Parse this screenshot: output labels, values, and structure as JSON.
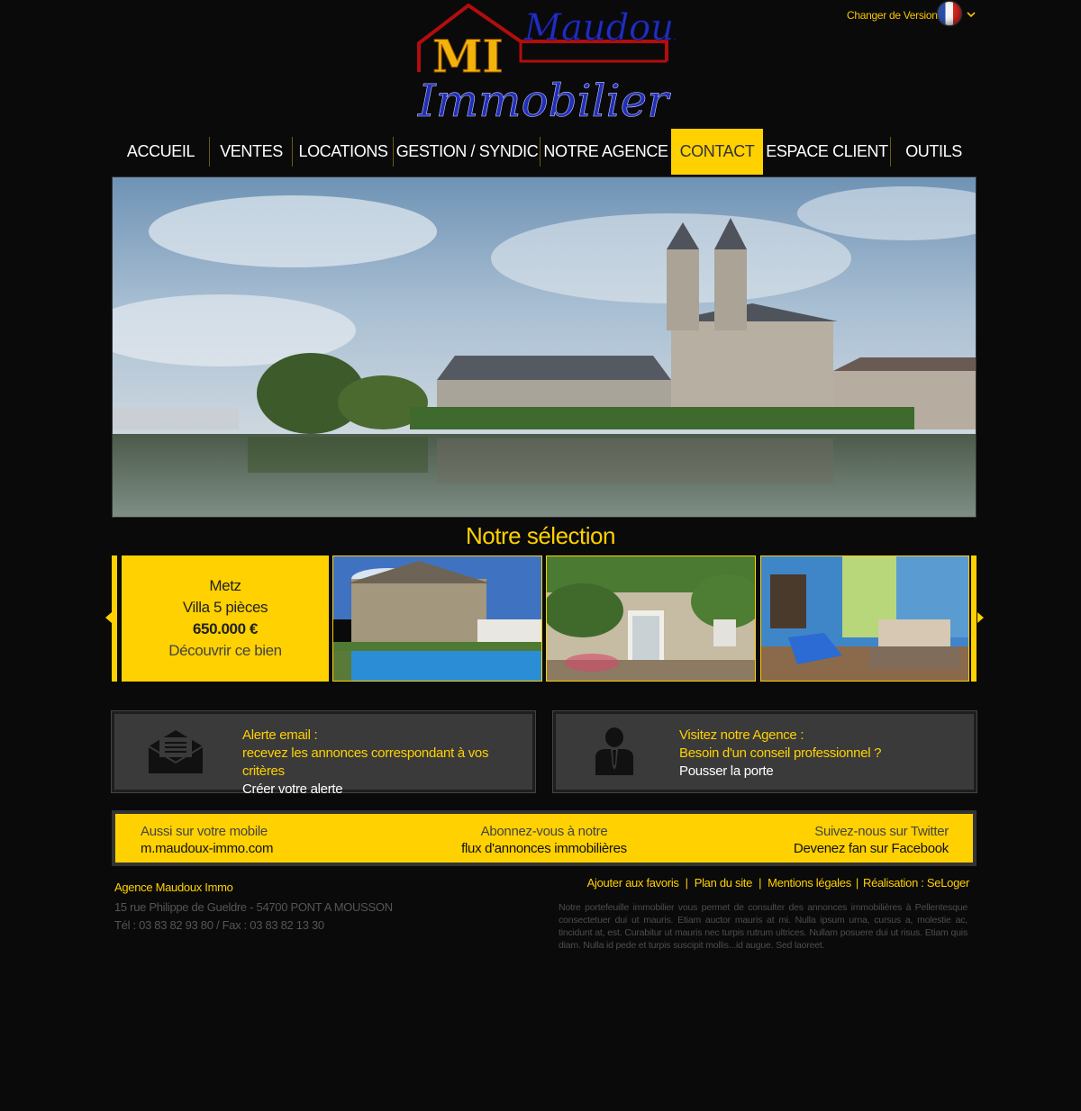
{
  "header": {
    "logo_word1": "Maudoux",
    "logo_word2": "Immobilier",
    "logo_mark": "MI",
    "version_label": "Changer de Version",
    "flag_icon": "french-flag-icon"
  },
  "nav": {
    "items": [
      {
        "label": "ACCUEIL"
      },
      {
        "label": "VENTES"
      },
      {
        "label": "LOCATIONS"
      },
      {
        "label": "GESTION / SYNDIC"
      },
      {
        "label": "NOTRE AGENCE"
      },
      {
        "label": "CONTACT"
      },
      {
        "label": "ESPACE CLIENT"
      },
      {
        "label": "OUTILS"
      }
    ],
    "active": "CONTACT"
  },
  "selection": {
    "title": "Notre sélection",
    "featured": {
      "city": "Metz",
      "type": "Villa 5 pièces",
      "price": "650.000 €",
      "cta": "Découvrir ce bien"
    }
  },
  "alert_box": {
    "line1": "Alerte email :",
    "line2": "recevez les annonces correspondant à vos critères",
    "cta": "Créer votre alerte"
  },
  "agency_box": {
    "line1": "Visitez notre Agence :",
    "line2": "Besoin d'un conseil professionnel ?",
    "cta": "Pousser la porte"
  },
  "band": {
    "mobile_a": "Aussi sur votre mobile",
    "mobile_b": "m.maudoux-immo.com",
    "rss_a": "Abonnez-vous à notre",
    "rss_b": "flux d'annonces immobilières",
    "social_a": "Suivez-nous sur Twitter",
    "social_b": "Devenez fan sur Facebook"
  },
  "footer": {
    "agency_name": "Agence Maudoux Immo",
    "address": "15 rue Philippe de Gueldre - 54700 PONT A MOUSSON",
    "phone": "Tél : 03 83 82 93 80 / Fax : 03 83 82 13 30",
    "links": [
      "Ajouter aux favoris",
      "Plan du site",
      "Mentions légales",
      "Réalisation : SeLoger"
    ],
    "lorem": "Notre portefeuille immobilier vous permet de consulter des annonces immobilières à Pellentesque consectetuer dui ut mauris. Etiam auctor mauris at mi. Nulla ipsum urna, cursus a, molestie ac, tincidunt at, est. Curabitur ut mauris nec turpis rutrum ultrices. Nullam posuere dui ut risus. Etiam quis diam. Nulla id pede et turpis suscipit mollis...id augue. Sed laoreet."
  },
  "colors": {
    "accent": "#ffd100",
    "background": "#0a0a0a",
    "box_bg": "#3a3a3a"
  }
}
